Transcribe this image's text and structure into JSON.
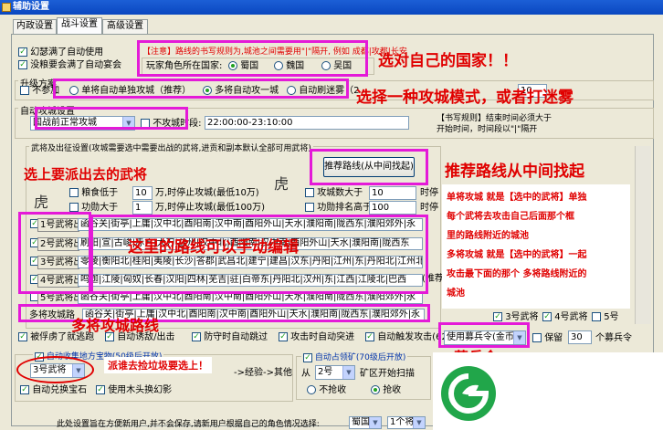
{
  "window": {
    "title": "辅助设置"
  },
  "tabs": [
    {
      "label": "内政设置"
    },
    {
      "label": "战斗设置"
    },
    {
      "label": "高级设置"
    }
  ],
  "options": {
    "auto_use": "幻瑟满了自动使用",
    "auto_banquet": "没粮要会满了自动宴会"
  },
  "notice": {
    "text": "【注意】路线的书写规则为,城池之间需要用\"|\"隔开, 例如 成都|攻都|长安"
  },
  "country": {
    "label": "玩家角色所在国家:",
    "shu": "蜀国",
    "wei": "魏国",
    "wu": "吴国"
  },
  "upgrade": {
    "group": "升级方案",
    "none": "不参加",
    "single": "单将自动单独攻城（推荐）",
    "multi": "多将自动攻一城",
    "fog": "自动刷迷雾（2",
    "right_val": "10"
  },
  "auto_attack": {
    "group": "自动攻城设置",
    "mode": "国战前正常攻城",
    "no_attack_label": "不攻城时段:",
    "no_attack_val": "22:00:00-23:10:00",
    "rule1": "【书写规则】结束时间必须大于",
    "rule2": "开始时间，时间段以\"|\"隔开"
  },
  "general": {
    "group": "武将及出征设置(攻城需要选中需要出战的武将,进贡和副本默认全部可用武将)",
    "recommend": "推荐路线(从中间找起)",
    "food_pre": "粮食低于",
    "food_val": "10",
    "food_suf": "万,时停止攻城(最低10万)",
    "merit_pre": "功勋大于",
    "merit_val": "1",
    "merit_suf": "万,时停止攻城(最低100万)",
    "city_pre": "攻城数大于",
    "city_val": "10",
    "city_suf": "时停",
    "up_pre": "功勋排名高于",
    "up_val": "100",
    "up_suf": "时停"
  },
  "generals": [
    {
      "label": "1号武将出征",
      "route": "函谷关|街亭|上庸|汉中北|酉阳南|汉中南|酉阳外山|天水|濮阳南|陇西东|濮阳郊外|永"
    },
    {
      "label": "2号武将出征",
      "route": "刷阳|宣|古峻|赤方|大刀|益州|汉中北|酉阳南|汉中南|酉阳外山|天水|濮阳南|陇西东"
    },
    {
      "label": "3号武将出征",
      "route": "零陵|衡阳北|桂阳|夷陵|长沙|答郡|武昌北|建宁|建昌|汉东|丹阳|江州|东|丹阳北|江州北|武"
    },
    {
      "label": "4号武将出征",
      "route": "鸣迦|江陵|匈奴|长春|汉阳|四林|芜吉|驻|白帝东|丹阳北|汉州|东|江西|江陵北|巴西"
    },
    {
      "label": "5号武将出征",
      "route": "函谷关|街亭|上庸|汉中北|酉阳南|汉中南|酉阳外山|天水|濮阳南|陇西东|濮阳郊外|永"
    }
  ],
  "recommend_word": "(推荐",
  "multi_route": {
    "label": "多将攻城路",
    "val": "函谷关|街亭|上庸|汉中北|酉阳南|汉中南|酉阳外山|天水|濮阳南|陇西东|濮阳郊外|永"
  },
  "checks_row": {
    "tiger": "被俘虏了就逃跑",
    "lure": "自动诱敌/出击",
    "prevent": "防守时自动跳过",
    "advance": "攻击时自动突进",
    "dong": "自动触发攻击(62级)",
    "ge3": "3号武将",
    "ge4": "4号武将",
    "ge5": "5号"
  },
  "recruit": {
    "val": "使用募兵令(金币)",
    "keep_label": "保留",
    "keep_val": "30",
    "suffix": "个募兵令"
  },
  "junk": {
    "group": "自动收集地方宝物(50级后开放)",
    "general": "3号武将",
    "text": "派谁去捡垃圾要选上！",
    "path": "->经验->其他",
    "gem": "自动兑换宝石",
    "axe": "使用木头换幻影"
  },
  "mine": {
    "group": "自动占领矿(70级后开放)",
    "from": "从",
    "num": "2号",
    "suf": "矿区开始扫描",
    "no_grab": "不抢收",
    "grab": "抢收"
  },
  "footer": {
    "text": "此处设置旨在方便新用户,并不会保存,请新用户根据自己的角色情况选择:",
    "country": "蜀国",
    "general": "1个将"
  },
  "annotations": {
    "country": "选对自己的国家！！",
    "mode": "选择一种攻城模式，或者打迷雾",
    "pick": "选上要派出去的武将",
    "recommend": "推荐路线从中间找起",
    "routes": "这里的路线可以手动编辑",
    "multi": "多将攻城路线",
    "recruit": "募兵令",
    "junk": "派谁去捡垃圾要选上！",
    "note_lines": [
      "单将攻城 就是【选中的武将】单独",
      "每个武将去攻击自己后面那个框",
      "里的路线附近的城池",
      "多将攻城 就是【选中的武将】一起",
      "攻击最下面的那个 多将路线附近的",
      "城池"
    ]
  },
  "colors": {
    "annotation": "#e00000",
    "highlight": "#e41ad8",
    "logo": "#21a64a"
  }
}
